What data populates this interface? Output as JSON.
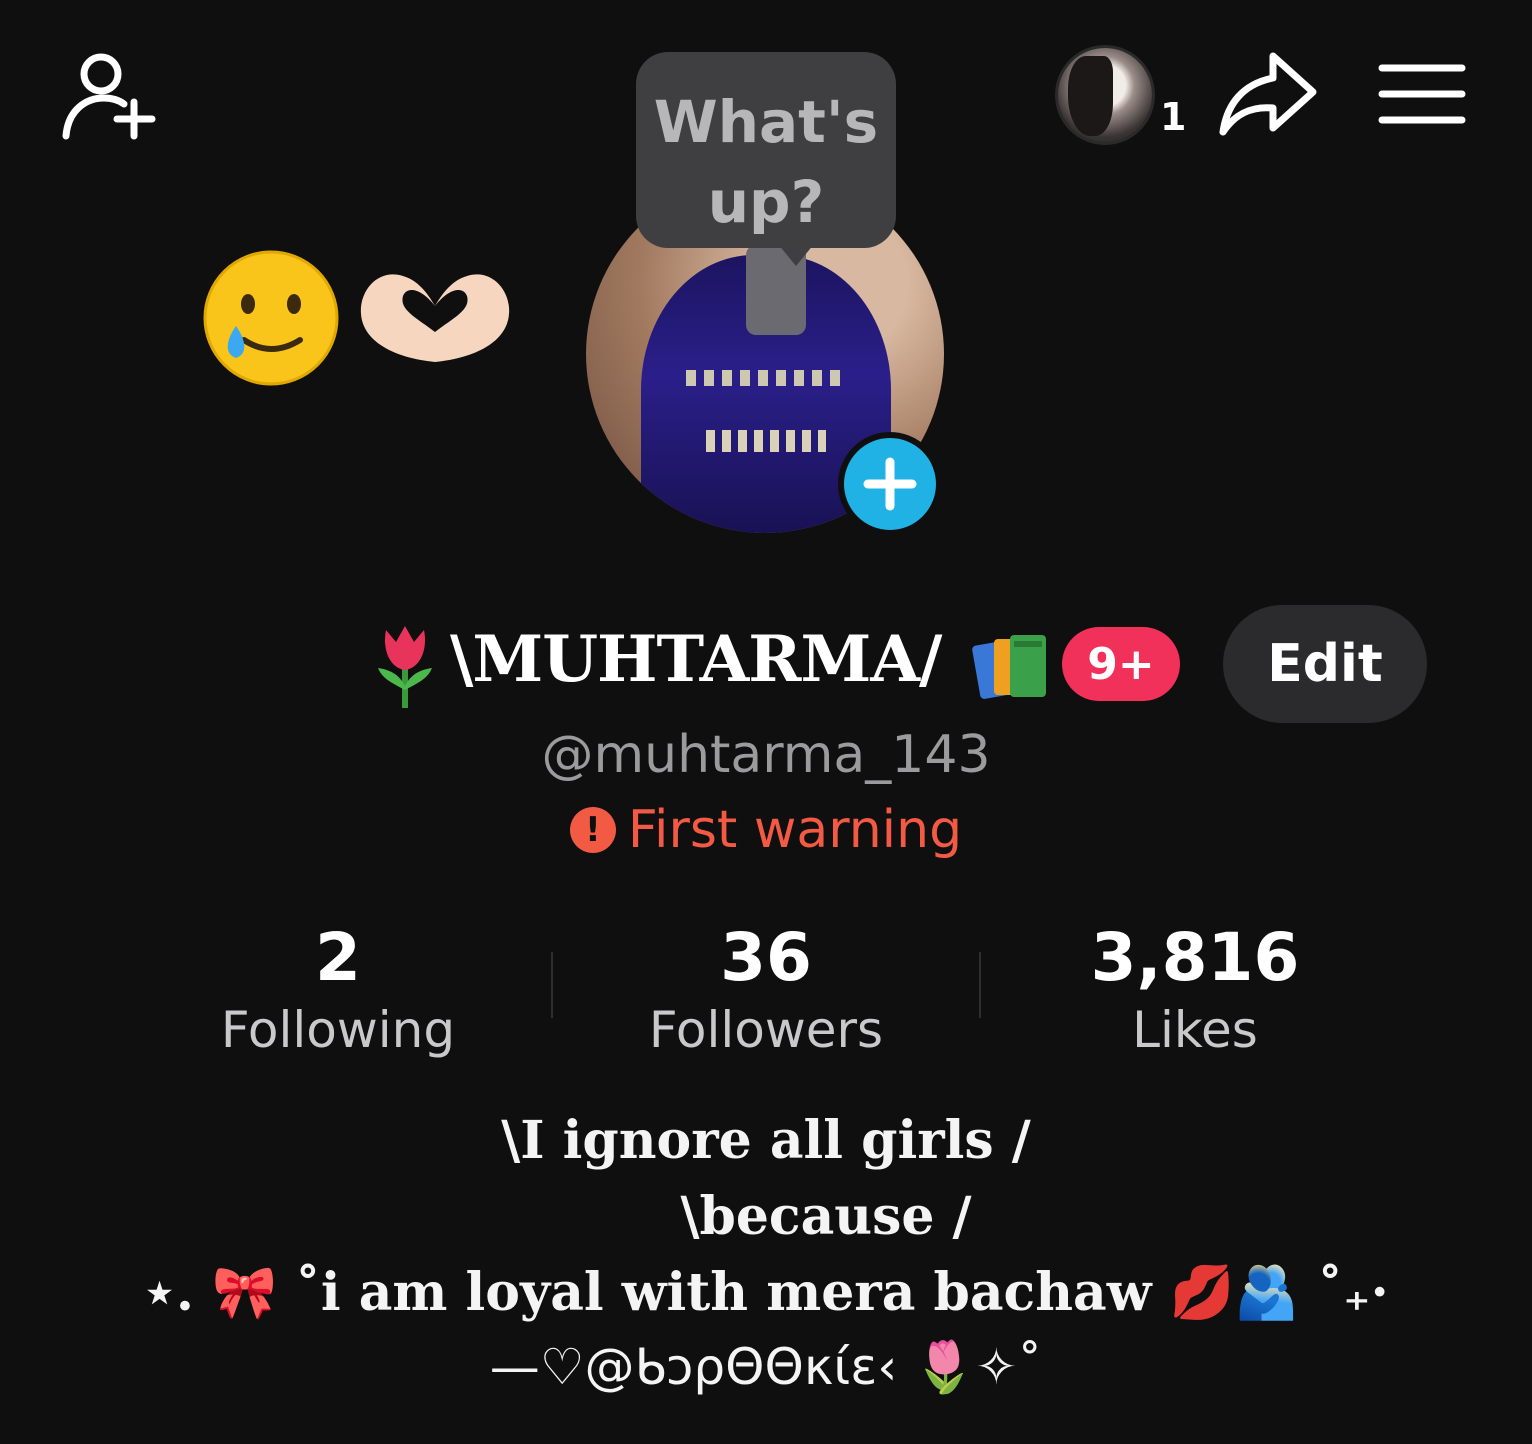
{
  "header": {
    "tooltip_text": "What's up?",
    "story_count": "1",
    "icons": {
      "add_friend": "add-user-icon",
      "share": "share-arrow-icon",
      "menu": "hamburger-menu-icon"
    }
  },
  "decoration": {
    "emojis": [
      "🥲",
      "🫶🏻"
    ]
  },
  "profile": {
    "name_prefix_emoji": "🌷",
    "display_name": "\\MUHTARMA/",
    "name_suffix_emoji": "📚",
    "notification_badge": "9+",
    "edit_label": "Edit",
    "username": "@muhtarma_143",
    "warning_text": "First warning",
    "warning_icon": "!"
  },
  "stats": [
    {
      "value": "2",
      "label": "Following"
    },
    {
      "value": "36",
      "label": "Followers"
    },
    {
      "value": "3,816",
      "label": "Likes"
    }
  ],
  "bio": {
    "line1": "\\I ignore all girls /",
    "line2": "\\because /",
    "line3": "⋆. 🎀 ˚i am loyal with mera bachaw 💋🫂 ˚₊·",
    "line4": "—♡@ᑲɔρΘΘκίε‹ 🌷✧˚"
  },
  "colors": {
    "background": "#0f0f10",
    "accent_blue": "#20b2e4",
    "badge_red": "#f2315a",
    "warning_red": "#f25a43",
    "muted_text": "#9b9b9d"
  }
}
